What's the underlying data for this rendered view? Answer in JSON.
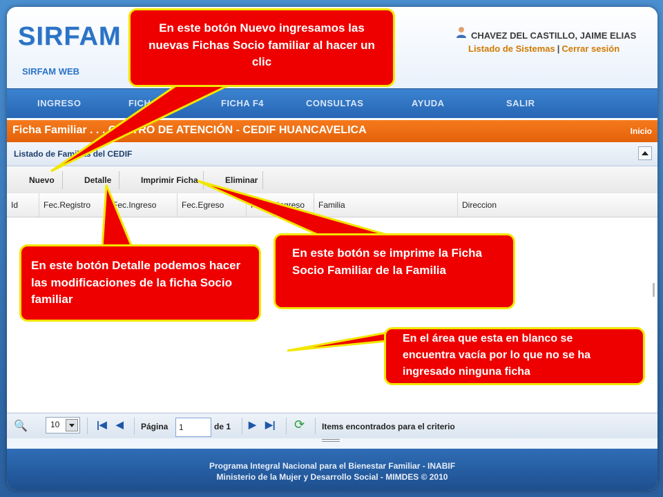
{
  "app": {
    "logo": "SIRFAM",
    "logo_sub": "SIRFAM WEB",
    "user_name": "CHAVEZ DEL CASTILLO, JAIME ELIAS",
    "link_systems": "Listado de Sistemas",
    "link_separator": "|",
    "link_logout": "Cerrar sesión"
  },
  "menu": {
    "items": [
      "INGRESO",
      "FICH",
      "FICHA F4",
      "CONSULTAS",
      "AYUDA",
      "SALIR"
    ]
  },
  "titlebar": {
    "title": "Ficha Familiar . . . CENTRO DE ATENCIÓN - CEDIF HUANCAVELICA",
    "home_link": "Inicio"
  },
  "grid": {
    "title": "Listado de Familias del CEDIF",
    "toolbar": [
      "Nuevo",
      "Detalle",
      "Imprimir Ficha",
      "Eliminar"
    ],
    "columns": [
      "Id",
      "Fec.Registro",
      "Fec.Ingreso",
      "Fec.Egreso",
      "Fec.Reingreso",
      "Familia",
      "Direccion"
    ]
  },
  "pager": {
    "page_size": "10",
    "page_label": "Página",
    "page_value": "1",
    "of_label": "de 1",
    "status": "Items encontrados para el criterio"
  },
  "footer": {
    "line1": "Programa Integral Nacional para el Bienestar Familiar - INABIF",
    "line2": "Ministerio de la Mujer y Desarrollo Social - MIMDES © 2010"
  },
  "callouts": {
    "nuevo": "En este botón Nuevo ingresamos las nuevas Fichas Socio familiar al hacer un clic",
    "detalle": "En este botón Detalle podemos hacer las modificaciones de la ficha Socio familiar",
    "imprimir": "En este botón se imprime la Ficha Socio Familiar de la Familia",
    "blanco": "En el área que esta en blanco se encuentra vacía  por lo que no se ha ingresado ninguna ficha"
  },
  "colors": {
    "accent": "#2b73c6",
    "title_orange": "#e4610a",
    "callout_red": "#ee0000",
    "callout_border": "#f2e600"
  }
}
